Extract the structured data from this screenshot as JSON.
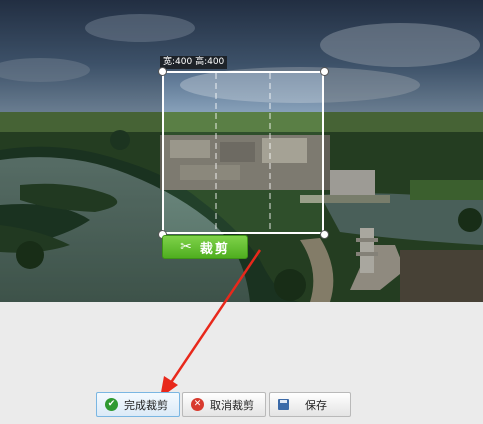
{
  "crop": {
    "size_label": "宽:400 高:400",
    "crop_button_label": "裁剪"
  },
  "toolbar": {
    "done_label": "完成裁剪",
    "cancel_label": "取消裁剪",
    "save_label": "保存"
  },
  "watermark": "",
  "colors": {
    "crop_button": "#5cbf2a",
    "done_icon": "#2f9a32",
    "cancel_icon": "#d83a2e",
    "save_icon": "#3b6aa8",
    "annotation_arrow": "#e8281b"
  }
}
